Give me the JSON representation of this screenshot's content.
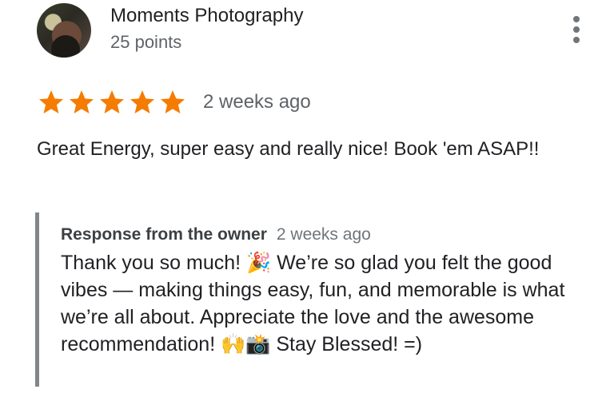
{
  "reviewer": {
    "name": "Moments Photography",
    "points": "25 points"
  },
  "rating": {
    "stars": 5,
    "max": 5,
    "time": "2 weeks ago"
  },
  "review_text": "Great Energy, super easy and really nice! Book 'em ASAP!!",
  "owner_response": {
    "label": "Response from the owner",
    "time": "2 weeks ago",
    "text_part1": "Thank you so much! ",
    "emoji1": "🎉",
    "text_part2": " We’re so glad you felt the good vibes — making things easy, fun, and memorable is what we’re all about. Appreciate the love and the awesome recommendation! ",
    "emoji2": "🙌",
    "emoji3": "📸",
    "text_part3": " Stay Blessed! =)"
  },
  "colors": {
    "star": "#f57c00",
    "secondary_text": "#5f6368",
    "response_bar": "#80868b"
  },
  "icons": {
    "more": "more-vert-icon",
    "star": "star-icon"
  }
}
